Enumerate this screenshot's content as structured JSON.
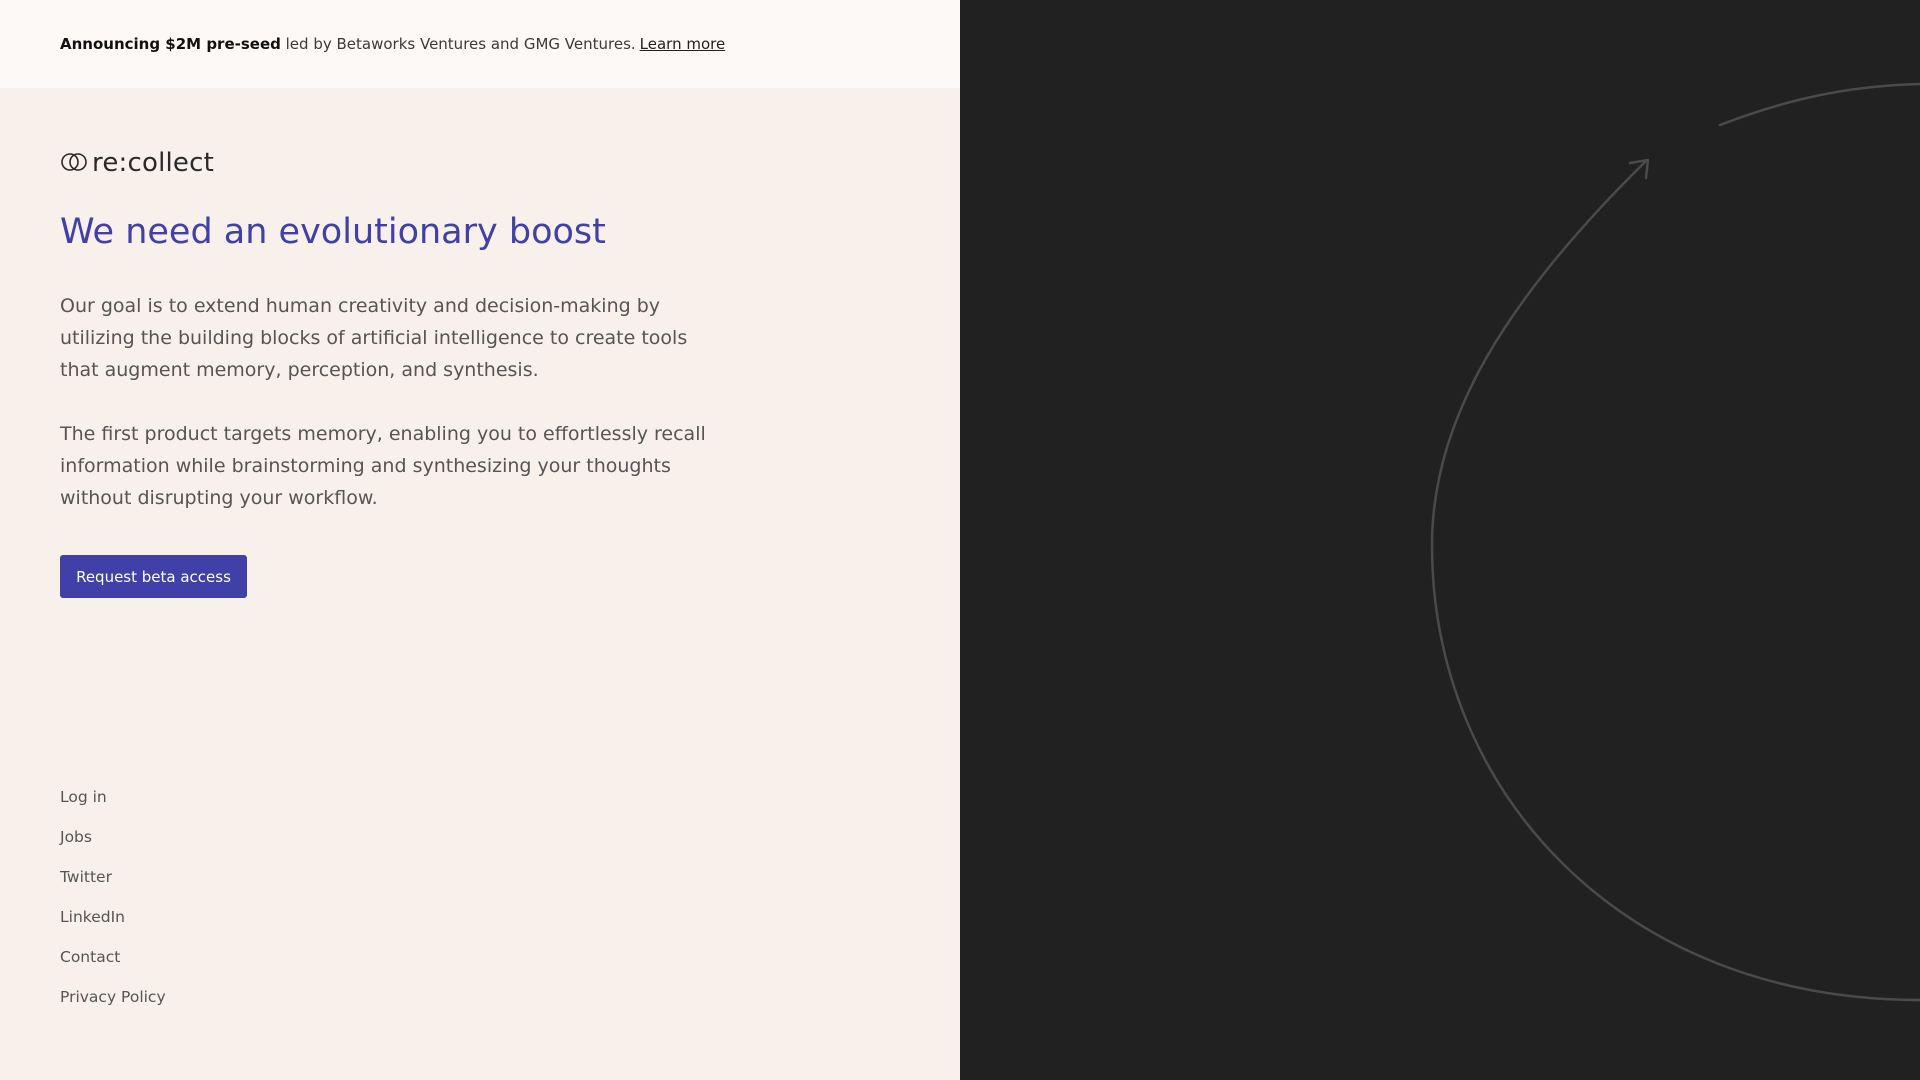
{
  "announcement": {
    "strong": "Announcing $2M pre-seed",
    "text": " led by Betaworks Ventures and GMG Ventures.",
    "link": "Learn more"
  },
  "brand": {
    "name": "re:collect",
    "logo_icon": "overlapping-circles-icon"
  },
  "hero": {
    "headline": "We need an evolutionary boost",
    "paragraphs": [
      "Our goal is to extend human creativity and decision-making by utilizing the building blocks of artificial intelligence to create tools that augment memory, perception, and synthesis.",
      "The first product targets memory, enabling you to effortlessly recall information while brainstorming and synthesizing your thoughts without disrupting your workflow."
    ],
    "cta_label": "Request beta access"
  },
  "footer": {
    "links": [
      "Log in",
      "Jobs",
      "Twitter",
      "LinkedIn",
      "Contact",
      "Privacy Policy"
    ]
  },
  "colors": {
    "accent": "#4040a8",
    "left_background": "#f8f0ea",
    "banner_background": "#fdf9f6",
    "right_background": "#212121",
    "arc_stroke": "#4a4a4a"
  },
  "decoration": {
    "arc_icon": "circular-arrow-icon"
  }
}
